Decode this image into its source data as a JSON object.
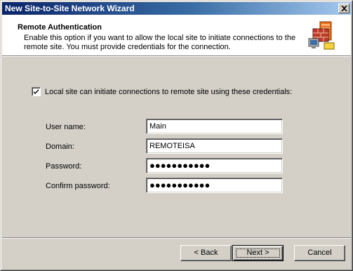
{
  "window": {
    "title": "New Site-to-Site Network Wizard"
  },
  "header": {
    "title": "Remote Authentication",
    "description": "Enable this option if you want to allow the local site to initiate connections to the remote site. You must provide credentials for the connection.",
    "icon": "network-wizard-icon"
  },
  "checkbox": {
    "label": "Local site can initiate connections to remote site using these credentials:",
    "checked": true
  },
  "fields": {
    "username": {
      "label": "User name:",
      "value": "Main"
    },
    "domain": {
      "label": "Domain:",
      "value": "REMOTEISA"
    },
    "password": {
      "label": "Password:",
      "value": "●●●●●●●●●●●"
    },
    "confirm": {
      "label": "Confirm password:",
      "value": "●●●●●●●●●●●"
    }
  },
  "buttons": {
    "back": "< Back",
    "next": "Next >",
    "cancel": "Cancel"
  },
  "colors": {
    "title_gradient_start": "#0a246a",
    "title_gradient_end": "#a6caf0",
    "dialog_face": "#d4d0c8",
    "header_bg": "#ffffff"
  }
}
